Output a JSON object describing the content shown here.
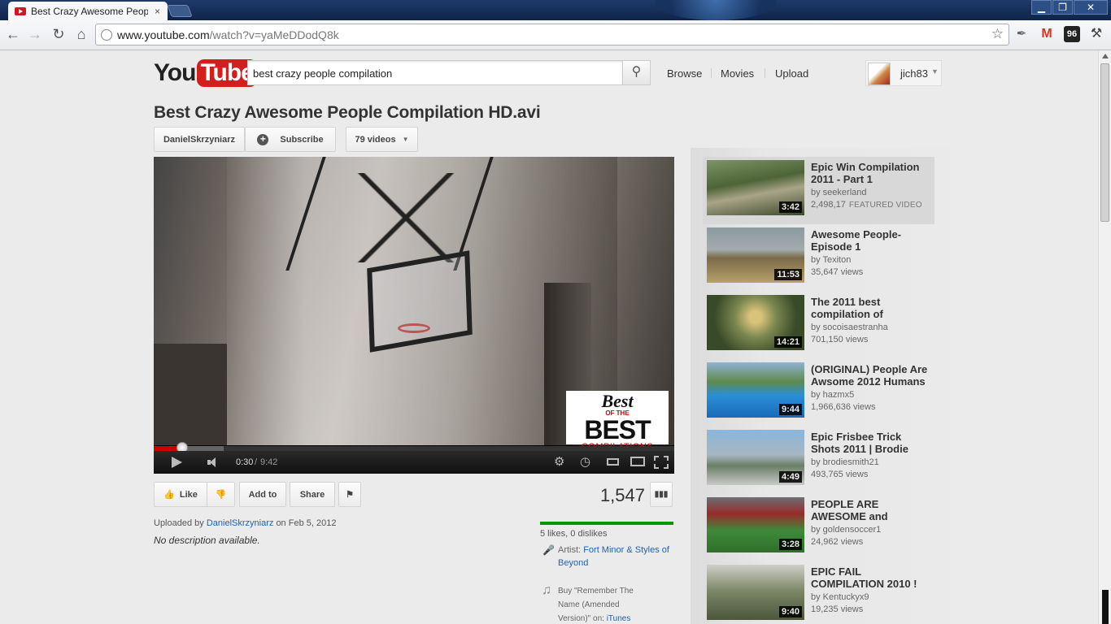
{
  "browser": {
    "tab_title": "Best Crazy Awesome People",
    "tab_close": "×",
    "url_host": "www.youtube.com",
    "url_path": "/watch?v=yaMeDDodQ8k",
    "window_min": "▁",
    "window_max": "❐",
    "window_close": "✕",
    "ext_gmail": "M",
    "ext_badge": "96"
  },
  "header": {
    "logo_you": "You",
    "logo_tube": "Tube",
    "search_query": "best crazy people compilation",
    "nav": [
      "Browse",
      "Movies",
      "Upload"
    ],
    "username": "jich83"
  },
  "video": {
    "title": "Best Crazy Awesome People Compilation HD.avi",
    "channel": "DanielSkrzyniarz",
    "subscribe_label": "Subscribe",
    "videos_label": "79 videos",
    "watermark_line1": "Best",
    "watermark_ofthe": "OF THE",
    "watermark_line2": "BEST",
    "watermark_line3": "COMPILATIONS",
    "time_current": "0:30",
    "time_separator": "/",
    "time_total": "9:42",
    "progress_played_fraction": 0.055,
    "progress_buffered_fraction": 0.135,
    "like_label": "Like",
    "addto_label": "Add to",
    "share_label": "Share",
    "view_count": "1,547",
    "likes_text": "5 likes, 0 dislikes",
    "uploaded_prefix": "Uploaded by",
    "uploaded_user": "DanielSkrzyniarz",
    "uploaded_suffix": "on Feb 5, 2012",
    "description": "No description available.",
    "artist_label": "Artist:",
    "artist_name": "Fort Minor & Styles of Beyond",
    "buy_text": "Buy \"Remember The Name (Amended Version)\" on:",
    "buy_store": "iTunes"
  },
  "related": [
    {
      "title": "Epic Win Compilation 2011 - Part 1",
      "by": "by seekerland",
      "views": "2,498,17",
      "badge": "FEATURED VIDEO",
      "duration": "3:42"
    },
    {
      "title": "Awesome People- Episode 1",
      "by": "by Texiton",
      "views": "35,647 views",
      "badge": "",
      "duration": "11:53"
    },
    {
      "title": "The 2011 best compilation of",
      "by": "by socoisaestranha",
      "views": "701,150 views",
      "badge": "",
      "duration": "14:21"
    },
    {
      "title": "(ORIGINAL) People Are Awsome 2012 Humans",
      "by": "by hazmx5",
      "views": "1,966,636 views",
      "badge": "",
      "duration": "9:44"
    },
    {
      "title": "Epic Frisbee Trick Shots 2011 | Brodie",
      "by": "by brodiesmith21",
      "views": "493,765 views",
      "badge": "",
      "duration": "4:49"
    },
    {
      "title": "PEOPLE ARE AWESOME and",
      "by": "by goldensoccer1",
      "views": "24,962 views",
      "badge": "",
      "duration": "3:28"
    },
    {
      "title": "EPIC FAIL COMPILATION 2010 !",
      "by": "by Kentuckyx9",
      "views": "19,235 views",
      "badge": "",
      "duration": "9:40"
    }
  ],
  "colors": {
    "brand_red": "#cc181e",
    "link_blue": "#1c62b9",
    "likes_green": "#009900"
  }
}
